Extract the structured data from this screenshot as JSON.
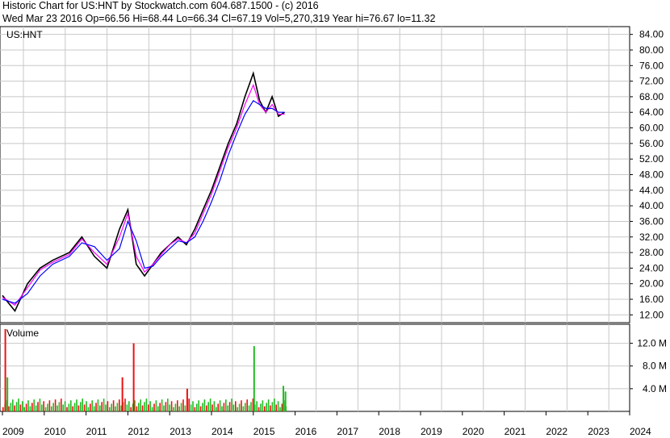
{
  "header": {
    "line1": "Historic Chart for US:HNT by Stockwatch.com 604.687.1500 - (c) 2016",
    "line2": "Wed Mar 23 2016   Op=66.56  Hi=68.44  Lo=66.34  Cl=67.19  Vol=5,270,319  Year hi=76.67  lo=11.32"
  },
  "chart_data": [
    {
      "type": "line",
      "title": "US:HNT",
      "ylim": [
        10,
        86
      ],
      "y_ticks": [
        "84.00",
        "80.00",
        "76.00",
        "72.00",
        "68.00",
        "64.00",
        "60.00",
        "56.00",
        "52.00",
        "48.00",
        "44.00",
        "40.00",
        "36.00",
        "32.00",
        "28.00",
        "24.00",
        "20.00",
        "16.00",
        "12.00"
      ],
      "grid": true,
      "colors": {
        "price": "#000000",
        "ma_short": "#ff00ff",
        "ma_long": "#0000ff"
      },
      "x": [
        2009.0,
        2009.3,
        2009.6,
        2009.9,
        2010.2,
        2010.6,
        2010.9,
        2011.2,
        2011.5,
        2011.8,
        2012.0,
        2012.2,
        2012.4,
        2012.6,
        2012.8,
        2013.0,
        2013.2,
        2013.4,
        2013.6,
        2013.8,
        2014.0,
        2014.2,
        2014.4,
        2014.6,
        2014.8,
        2015.0,
        2015.15,
        2015.3,
        2015.45,
        2015.6,
        2015.75
      ],
      "series": [
        {
          "name": "price",
          "values": [
            17,
            13,
            20,
            24,
            26,
            28,
            32,
            27,
            24,
            34,
            39,
            25,
            22,
            25,
            28,
            30,
            32,
            30,
            34,
            39,
            44,
            50,
            56,
            61,
            68,
            74,
            67,
            64,
            68,
            63,
            64
          ]
        },
        {
          "name": "ma_short",
          "values": [
            16.5,
            14.5,
            19,
            23.5,
            25.5,
            27.5,
            31.5,
            28,
            25,
            32,
            38,
            27,
            23,
            25,
            27.5,
            30,
            31.5,
            30.5,
            33,
            38,
            43,
            49,
            55,
            60,
            66,
            71,
            66,
            64,
            66,
            63.5,
            63.5
          ]
        },
        {
          "name": "ma_long",
          "values": [
            16,
            15,
            17.5,
            22,
            25,
            27,
            30.5,
            29.5,
            26,
            29,
            36,
            31,
            24,
            24.5,
            27,
            29,
            31,
            30.5,
            32,
            36,
            41,
            46.5,
            53,
            58.5,
            63.5,
            67,
            66,
            65,
            65,
            64,
            64
          ]
        }
      ]
    },
    {
      "type": "bar",
      "title": "Volume",
      "ylim": [
        0,
        14.5
      ],
      "y_ticks": [
        "12.0 M",
        "8.0 M",
        "4.0 M"
      ],
      "x_ticks": [
        "2009",
        "2010",
        "2011",
        "2012",
        "2013",
        "2014",
        "2015",
        "2016",
        "2017",
        "2018",
        "2019",
        "2020",
        "2021",
        "2022",
        "2023",
        "2024"
      ],
      "colors": {
        "up": "#22bb22",
        "down": "#ee1111"
      },
      "spikes": [
        {
          "x": 2009.05,
          "value": 14.5,
          "color": "red"
        },
        {
          "x": 2009.1,
          "value": 6.0,
          "color": "green"
        },
        {
          "x": 2011.85,
          "value": 6.0,
          "color": "red"
        },
        {
          "x": 2012.12,
          "value": 12.0,
          "color": "red"
        },
        {
          "x": 2013.4,
          "value": 4.0,
          "color": "red"
        },
        {
          "x": 2015.0,
          "value": 11.5,
          "color": "green"
        },
        {
          "x": 2015.7,
          "value": 4.5,
          "color": "green"
        },
        {
          "x": 2015.75,
          "value": 3.5,
          "color": "green"
        }
      ],
      "baseline_level": 1.5
    }
  ]
}
